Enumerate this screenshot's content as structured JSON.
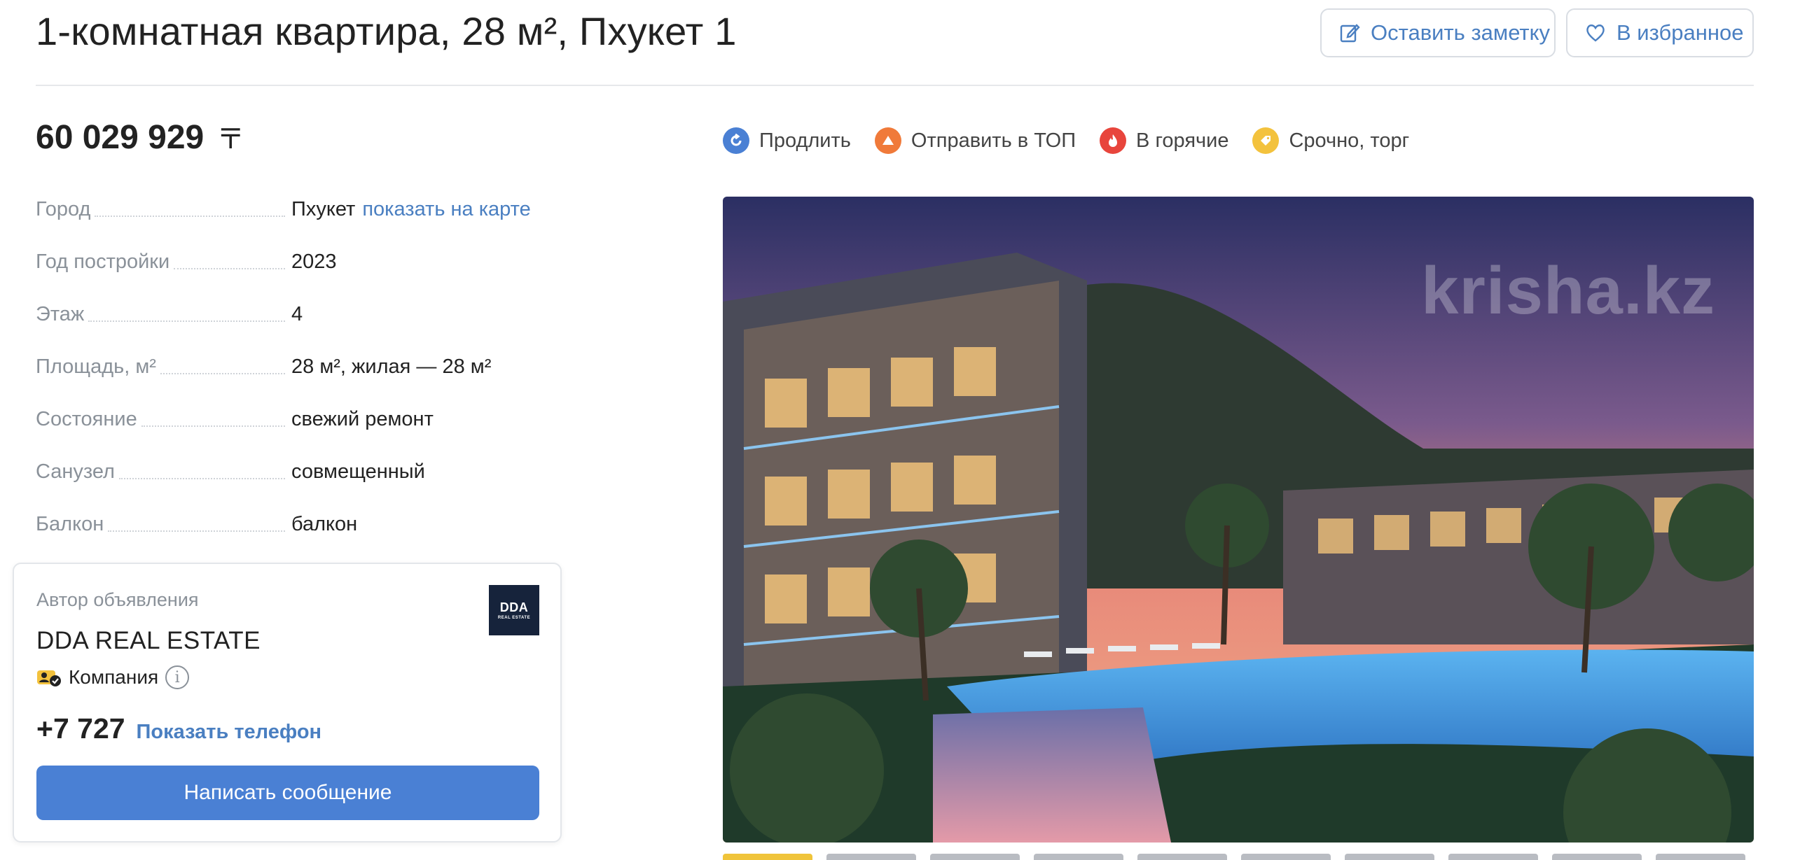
{
  "header": {
    "title": "1-комнатная квартира, 28 м², Пхукет 1",
    "note_button": "Оставить заметку",
    "favorite_button": "В избранное"
  },
  "price": {
    "amount": "60 029 929",
    "currency": "〒"
  },
  "params": [
    {
      "label": "Город",
      "value": "Пхукет",
      "link": "показать на карте"
    },
    {
      "label": "Год постройки",
      "value": "2023"
    },
    {
      "label": "Этаж",
      "value": "4"
    },
    {
      "label": "Площадь, м²",
      "value": "28 м², жилая — 28 м²"
    },
    {
      "label": "Состояние",
      "value": "свежий ремонт"
    },
    {
      "label": "Санузел",
      "value": "совмещенный"
    },
    {
      "label": "Балкон",
      "value": "балкон"
    }
  ],
  "actions": [
    {
      "label": "Продлить",
      "icon": "renew-icon",
      "color": "#4a80d4"
    },
    {
      "label": "Отправить в ТОП",
      "icon": "top-icon",
      "color": "#f07a3a"
    },
    {
      "label": "В горячие",
      "icon": "fire-icon",
      "color": "#e8453c"
    },
    {
      "label": "Срочно, торг",
      "icon": "urgent-icon",
      "color": "#f3c23d"
    }
  ],
  "photo": {
    "watermark": "krisha.kz"
  },
  "author": {
    "label": "Автор объявления",
    "name": "DDA REAL ESTATE",
    "logo_text": "DDA",
    "logo_subtext": "REAL ESTATE",
    "type": "Компания",
    "phone": "+7 727",
    "show_phone": "Показать телефон",
    "message_button": "Написать сообщение"
  },
  "colors": {
    "link": "#4a7fc1",
    "primary_button": "#4a80d4",
    "muted_text": "#8a9199"
  }
}
